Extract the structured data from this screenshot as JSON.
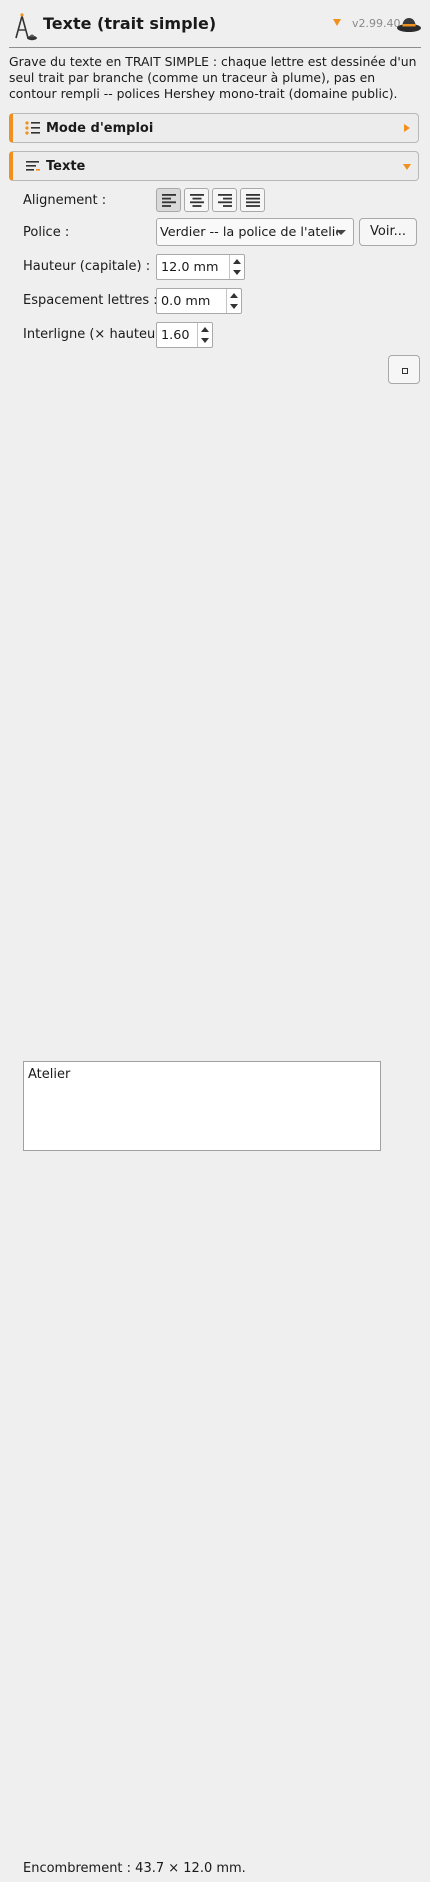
{
  "header": {
    "title": "Texte (trait simple)",
    "version": "v2.99.40"
  },
  "description": "Grave du texte en TRAIT SIMPLE : chaque lettre est dessinée d'un seul trait par branche (comme un traceur à plume), pas en contour rempli -- polices Hershey mono-trait (domaine public).",
  "sections": {
    "usage": {
      "label": "Mode d'emploi",
      "state": "collapsed"
    },
    "text": {
      "label": "Texte",
      "state": "expanded"
    }
  },
  "form": {
    "alignment": {
      "label": "Alignement :",
      "options": [
        "align-left",
        "align-center",
        "align-right",
        "align-justify"
      ],
      "selected": "align-left"
    },
    "font": {
      "label": "Police :",
      "value": "Verdier -- la police de l'atelier (c",
      "browse_label": "Voir..."
    },
    "cap_height": {
      "label": "Hauteur (capitale) :",
      "value": "12.0 mm"
    },
    "letter_spacing": {
      "label": "Espacement lettres :",
      "value": "0.0 mm"
    },
    "line_spacing": {
      "label": "Interligne (× hauteur) :",
      "value": "1.60"
    }
  },
  "text_input": {
    "value": "Atelier"
  },
  "footer": {
    "bounding_box": "Encombrement : 43.7 × 12.0 mm."
  },
  "colors": {
    "accent": "#f0901e",
    "background": "#efefef",
    "border": "#a9a9a9"
  }
}
